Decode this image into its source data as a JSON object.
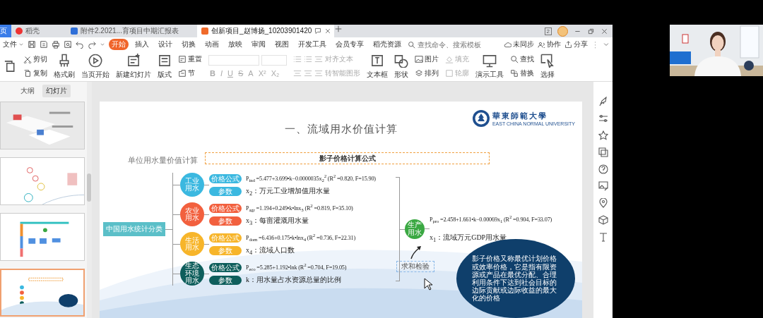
{
  "tabs": [
    {
      "label": "页",
      "selected": false,
      "kind": "home"
    },
    {
      "label": "稻壳",
      "selected": false,
      "kind": "docer"
    },
    {
      "label": "附件2.2021...育项目中期汇报表",
      "selected": false,
      "kind": "word"
    },
    {
      "label": "创新项目_赵博扬_10203901420",
      "selected": true,
      "kind": "ppt"
    }
  ],
  "window_badge": "2",
  "menu": {
    "file": "文件",
    "tabs": [
      {
        "label": "开始",
        "selected": true
      },
      {
        "label": "插入",
        "selected": false
      },
      {
        "label": "设计",
        "selected": false
      },
      {
        "label": "切换",
        "selected": false
      },
      {
        "label": "动画",
        "selected": false
      },
      {
        "label": "放映",
        "selected": false
      },
      {
        "label": "审阅",
        "selected": false
      },
      {
        "label": "视图",
        "selected": false
      },
      {
        "label": "开发工具",
        "selected": false
      },
      {
        "label": "会员专享",
        "selected": false
      },
      {
        "label": "稻壳资源",
        "selected": false
      }
    ],
    "search": {
      "placeholder": "查找命令、搜索模板"
    },
    "actions": [
      "未同步",
      "协作",
      "分享"
    ]
  },
  "ribbon": [
    {
      "kind": "stack",
      "items": [
        "剪切",
        "复制"
      ],
      "disabled": false
    },
    {
      "kind": "big",
      "label": "格式刷",
      "disabled": false
    },
    {
      "kind": "big",
      "label": "当页开始",
      "disabled": false
    },
    {
      "kind": "big",
      "label": "新建幻灯片",
      "disabled": false
    },
    {
      "kind": "big",
      "label": "版式",
      "disabled": false
    },
    {
      "kind": "stack",
      "items": [
        "重置",
        "节"
      ],
      "disabled": false
    },
    {
      "kind": "font",
      "glyphs": [
        "B",
        "I",
        "U",
        "S",
        "A",
        "X²",
        "X₂"
      ],
      "disabled": true
    },
    {
      "kind": "paragraph",
      "items": [
        "对齐文本",
        "转智能图形"
      ],
      "disabled": true
    },
    {
      "kind": "big",
      "label": "文本框",
      "disabled": false
    },
    {
      "kind": "big",
      "label": "形状",
      "disabled": false
    },
    {
      "kind": "stack",
      "items": [
        "图片",
        "排列"
      ],
      "disabled": false
    },
    {
      "kind": "stack",
      "items": [
        "填充",
        "轮廓"
      ],
      "disabled": true
    },
    {
      "kind": "big",
      "label": "演示工具",
      "disabled": false
    },
    {
      "kind": "stack",
      "items": [
        "查找",
        "替换"
      ],
      "disabled": false
    },
    {
      "kind": "big",
      "label": "选择",
      "disabled": false
    }
  ],
  "left_pane": {
    "tabs": [
      {
        "label": "大纲",
        "selected": false
      },
      {
        "label": "幻灯片",
        "selected": true
      }
    ],
    "slides": [
      {
        "selected": false
      },
      {
        "selected": false
      },
      {
        "selected": false
      },
      {
        "selected": true
      }
    ]
  },
  "slide": {
    "title": "一、流域用水价值计算",
    "logo": {
      "name": "華東師範大學",
      "subtitle": "EAST CHINA NORMAL UNIVERSITY"
    },
    "section_label": "单位用水量价值计算",
    "formula_header": "影子价格计算公式",
    "root": "中国用水统计分类",
    "branches": [
      {
        "label": "工业用水",
        "color": "#3bb8e0",
        "pills": [
          "价格公式",
          "参数"
        ],
        "formula": "P$_{ind}$ =5.477+3.699•k−0.0000035x$_{2}$$^{2}$ (R$^{2}$ =0.820, F=15.90)",
        "param": "x$_{2}$：万元工业增加值用水量"
      },
      {
        "label": "农业用水",
        "color": "#f2603e",
        "pills": [
          "价格公式",
          "参数"
        ],
        "formula": "P$_{agr}$ =1.194+0.249•k•lnx$_{3}$ (R$^{2}$ =0.819, F=35.10)",
        "param": "x$_{3}$：每亩灌溉用水量"
      },
      {
        "label": "生活用水",
        "color": "#f7b52a",
        "pills": [
          "价格公式",
          "参数"
        ],
        "formula": "P$_{dom}$ =6.436+0.175•k•lnx$_{4}$ (R$^{2}$ =0.736, F=22.31)",
        "param": "x$_{4}$：流域人口数"
      },
      {
        "label": "生态环境用水",
        "color": "#0e5e5c",
        "pills": [
          "价格公式",
          "参数"
        ],
        "formula": "P$_{eco}$ =5.285+1.192•lnk (R$^{2}$ =0.704, F=19.05)",
        "param": "k：用水量占水资源总量的比例"
      }
    ],
    "production": {
      "label": "生产用水",
      "color": "#3aa842",
      "formula": "P$_{pro}$ =2.458+1.661•k−0.00069x$_{1}$ (R$^{2}$ =0.904, F=33.07)",
      "param": "x$_{1}$：流域万元GDP用水量"
    },
    "check": "求和检验",
    "bubble": "影子价格又称最优计划价格或效率价格，它是指有限资源或产品在最优分配、合理利用条件下达到社会目标的边际贡献或边际收益的最大化的价格"
  }
}
